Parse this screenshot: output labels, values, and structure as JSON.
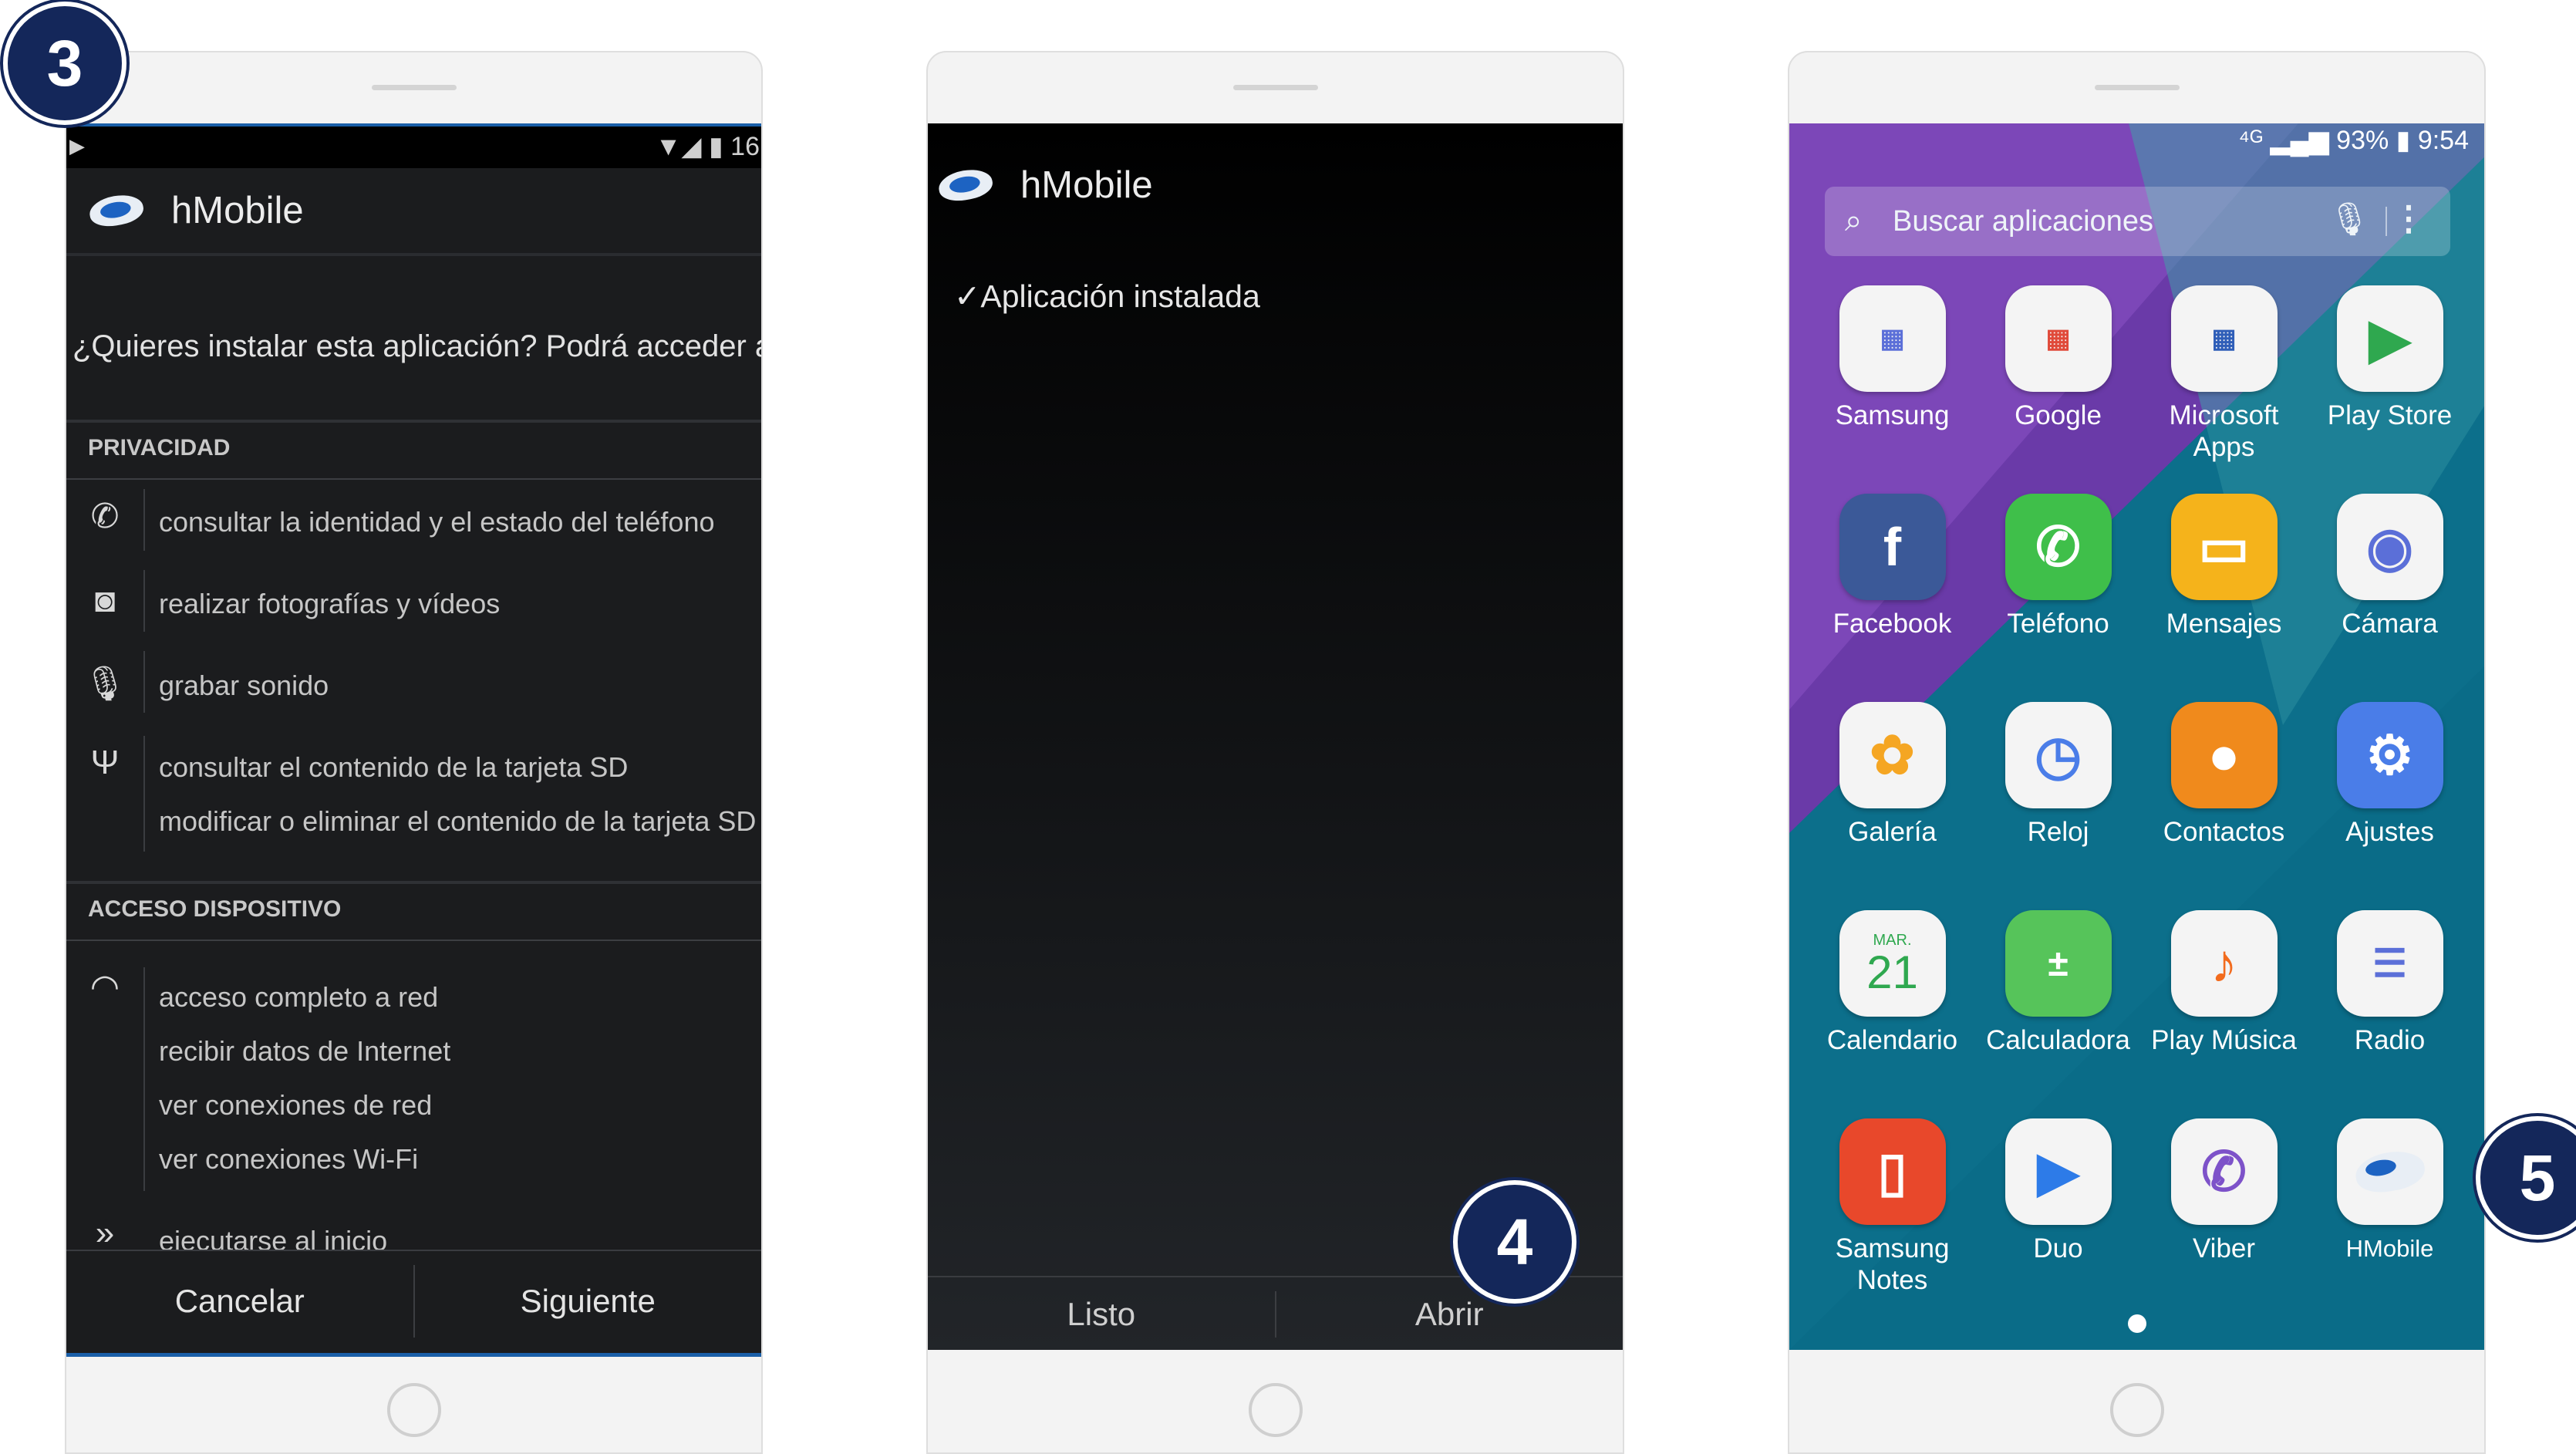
{
  "badges": {
    "step3": "3",
    "step4": "4",
    "step5": "5"
  },
  "screen1": {
    "status_time": "16",
    "app_title": "hMobile",
    "question": "¿Quieres instalar esta aplicación? Podrá acceder a",
    "section_privacy": "PRIVACIDAD",
    "perm_phone": "consultar la identidad y el estado del teléfono",
    "perm_camera": "realizar fotografías y vídeos",
    "perm_mic": "grabar sonido",
    "perm_sd_read": "consultar el contenido de la tarjeta SD",
    "perm_sd_write": "modificar o eliminar el contenido de la tarjeta SD",
    "section_device": "ACCESO DISPOSITIVO",
    "perm_net_full": "acceso completo a red",
    "perm_net_data": "recibir datos de Internet",
    "perm_net_conn": "ver conexiones de red",
    "perm_wifi_conn": "ver conexiones Wi-Fi",
    "perm_boot": "ejecutarse al inicio",
    "cancel_label": "Cancelar",
    "next_label": "Siguiente"
  },
  "screen2": {
    "app_title": "hMobile",
    "installed": "Aplicación instalada",
    "done_label": "Listo",
    "open_label": "Abrir"
  },
  "screen3": {
    "status": "93% ▮ 9:54",
    "search_placeholder": "Buscar aplicaciones",
    "apps": [
      {
        "label": "Samsung",
        "icon": "samsung-folder-icon",
        "color": "#f0f0f0"
      },
      {
        "label": "Google",
        "icon": "google-folder-icon",
        "color": "#f0f0f0"
      },
      {
        "label": "Microsoft Apps",
        "icon": "microsoft-folder-icon",
        "color": "#f0f0f0"
      },
      {
        "label": "Play Store",
        "icon": "play-store-icon",
        "color": "#f4f4f4"
      },
      {
        "label": "Facebook",
        "icon": "facebook-icon",
        "color": "#3b5998"
      },
      {
        "label": "Teléfono",
        "icon": "phone-icon",
        "color": "#3fbf4a"
      },
      {
        "label": "Mensajes",
        "icon": "messages-icon",
        "color": "#f5b31b"
      },
      {
        "label": "Cámara",
        "icon": "camera-icon",
        "color": "#5b6fd8"
      },
      {
        "label": "Galería",
        "icon": "gallery-icon",
        "color": "#f5a623"
      },
      {
        "label": "Reloj",
        "icon": "clock-icon",
        "color": "#eef2f8"
      },
      {
        "label": "Contactos",
        "icon": "contacts-icon",
        "color": "#f08a1c"
      },
      {
        "label": "Ajustes",
        "icon": "settings-icon",
        "color": "#4a7de8"
      },
      {
        "label": "Calendario",
        "icon": "calendar-icon",
        "color": "#ffffff"
      },
      {
        "label": "Calculadora",
        "icon": "calculator-icon",
        "color": "#56c45a"
      },
      {
        "label": "Play Música",
        "icon": "play-music-icon",
        "color": "#f26b1d"
      },
      {
        "label": "Radio",
        "icon": "radio-icon",
        "color": "#f4f4f4"
      },
      {
        "label": "Samsung Notes",
        "icon": "samsung-notes-icon",
        "color": "#e8482b"
      },
      {
        "label": "Duo",
        "icon": "duo-icon",
        "color": "#2d7be8"
      },
      {
        "label": "Viber",
        "icon": "viber-icon",
        "color": "#7d52c9"
      },
      {
        "label": "HMobile",
        "icon": "hmobile-icon",
        "color": "#e8eef5"
      }
    ],
    "calendar_month": "MAR.",
    "calendar_day": "21"
  }
}
